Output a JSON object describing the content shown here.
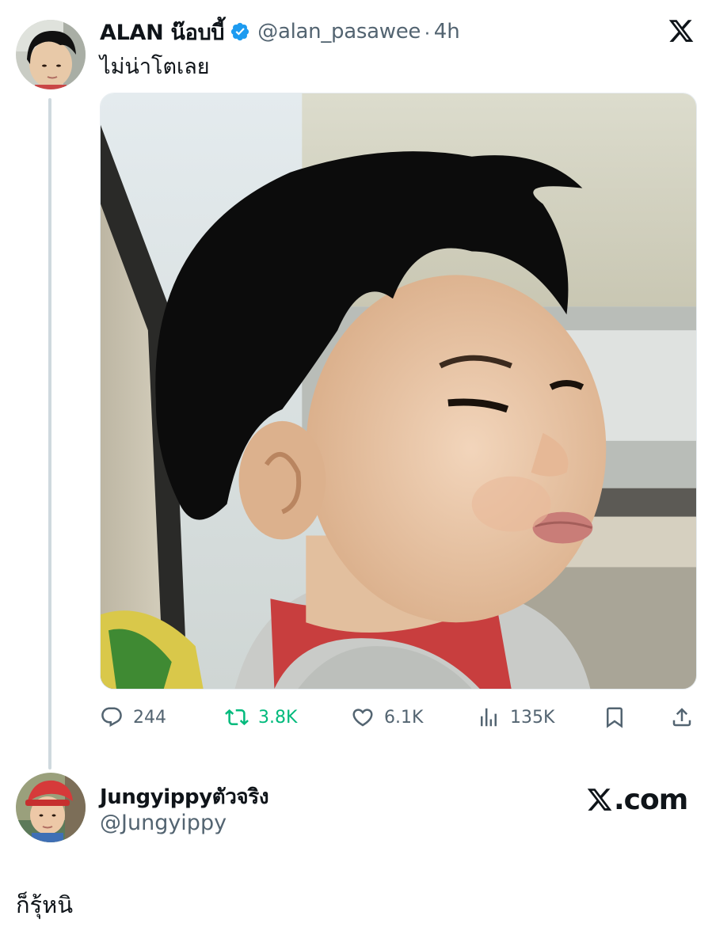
{
  "tweet": {
    "display_name": "ALAN น๊อบบี้",
    "handle": "@alan_pasawee",
    "separator": "·",
    "time": "4h",
    "text": "ไม่น่าโตเลย",
    "verified_icon": "verified-badge-icon",
    "brand_icon": "x-logo-icon",
    "photo_subject": "toddler-in-car-photo"
  },
  "actions": {
    "replies": "244",
    "retweets": "3.8K",
    "likes": "6.1K",
    "views": "135K"
  },
  "colors": {
    "text_primary": "#0f1419",
    "text_secondary": "#536471",
    "retweet_green": "#00ba7c",
    "verified_blue": "#1d9bf0",
    "thread_line": "#cfd9de"
  },
  "quote_user": {
    "display_name": "Jungyippyตัวจริง",
    "handle": "@Jungyippy",
    "site": ".com"
  },
  "caption": "ก็รุ้หนิ"
}
